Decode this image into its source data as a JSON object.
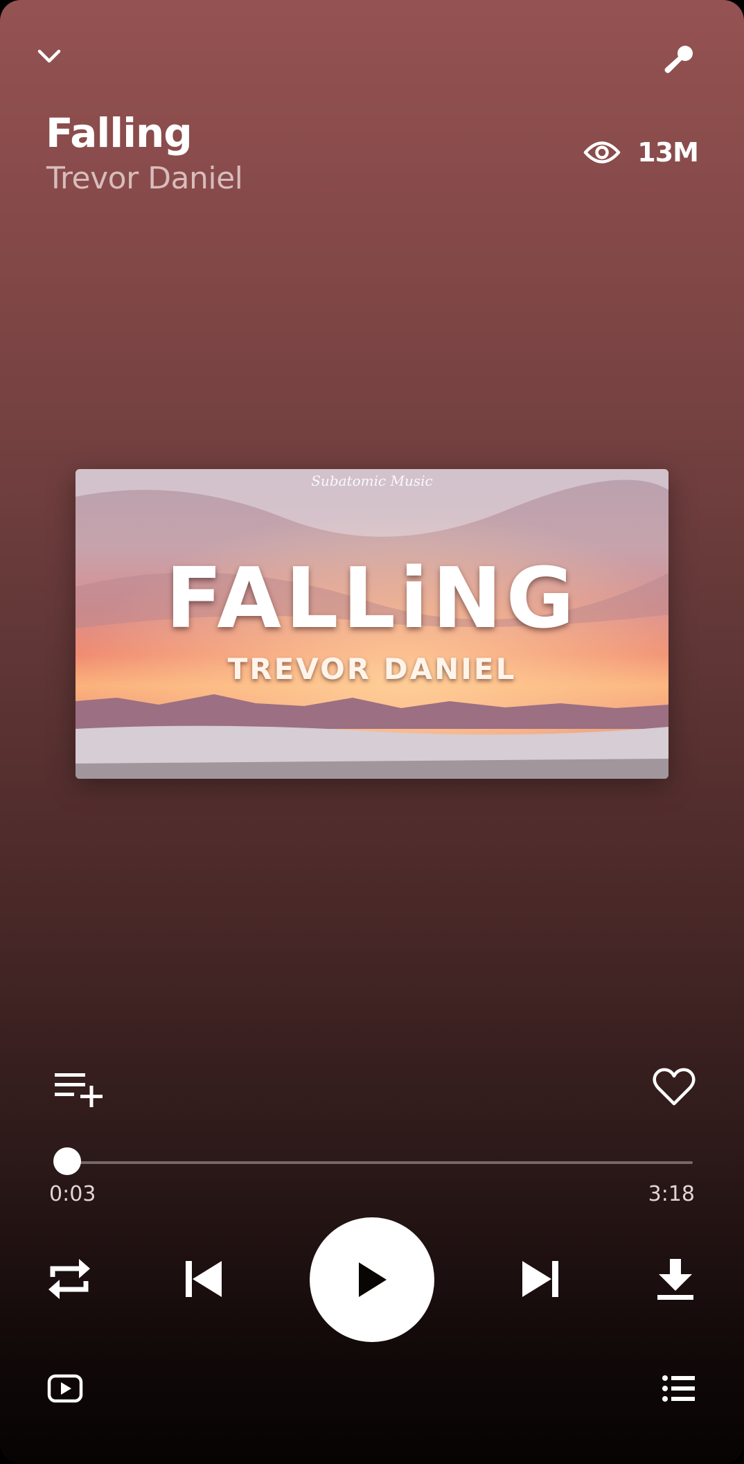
{
  "track": {
    "title": "Falling",
    "artist": "Trevor Daniel",
    "views": "13M"
  },
  "artwork": {
    "title_text": "FALLiNG",
    "artist_text": "TREVOR DANIEL",
    "logo_text": "Subatomic Music"
  },
  "playback": {
    "elapsed": "0:03",
    "duration": "3:18",
    "progress_fraction": 0.016
  },
  "icons": {
    "collapse": "chevron-down-icon",
    "lyrics": "microphone-icon",
    "views": "eye-icon",
    "add_to_playlist": "playlist-add-icon",
    "like": "heart-outline-icon",
    "repeat": "repeat-icon",
    "previous": "skip-previous-icon",
    "play": "play-icon",
    "next": "skip-next-icon",
    "download": "download-icon",
    "video": "youtube-video-icon",
    "queue": "queue-list-icon"
  },
  "colors": {
    "gradient_top": "#955252",
    "gradient_bottom": "#070303",
    "artist_text": "#d9bcbc"
  }
}
